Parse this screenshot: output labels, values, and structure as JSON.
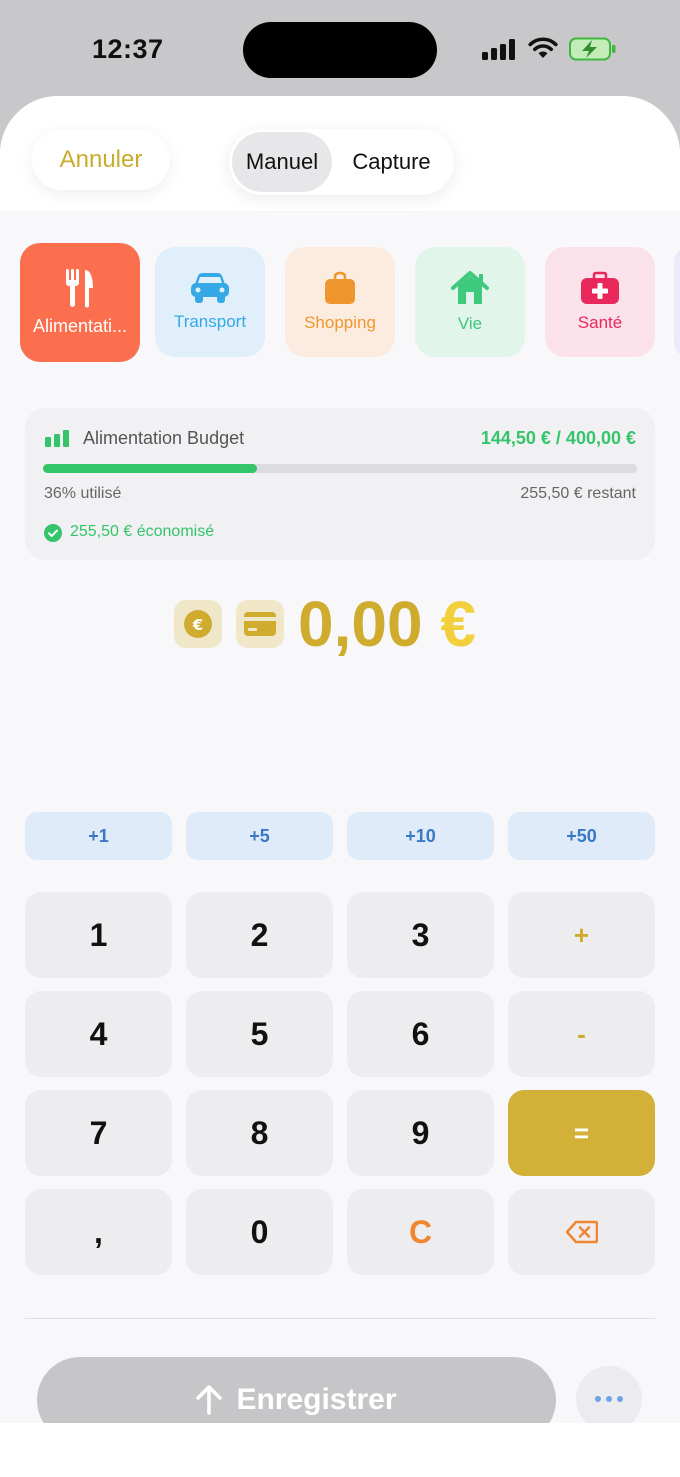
{
  "status_bar": {
    "time": "12:37"
  },
  "header": {
    "cancel_label": "Annuler",
    "tabs": [
      {
        "label": "Manuel",
        "active": true
      },
      {
        "label": "Capture",
        "active": false
      }
    ]
  },
  "categories": [
    {
      "label": "Alimentati...",
      "icon": "fork-knife-icon",
      "color": "#fb6f4f",
      "selected": true
    },
    {
      "label": "Transport",
      "icon": "car-icon",
      "color": "#35a9e6"
    },
    {
      "label": "Shopping",
      "icon": "bag-icon",
      "color": "#f0962e"
    },
    {
      "label": "Vie",
      "icon": "house-icon",
      "color": "#3ec97c"
    },
    {
      "label": "Santé",
      "icon": "medical-kit-icon",
      "color": "#e8285a"
    }
  ],
  "budget": {
    "title": "Alimentation Budget",
    "amount": "144,50 € / 400,00 €",
    "progress_fraction": 0.36,
    "used": "36% utilisé",
    "remaining": "255,50 € restant",
    "saved": "255,50 € économisé"
  },
  "amount": {
    "value": "0,00",
    "currency": "€"
  },
  "quick_add": [
    "+1",
    "+5",
    "+10",
    "+50"
  ],
  "keypad": {
    "rows": [
      [
        "1",
        "2",
        "3",
        "+"
      ],
      [
        "4",
        "5",
        "6",
        "-"
      ],
      [
        "7",
        "8",
        "9",
        "="
      ],
      [
        ",",
        "0",
        "C",
        "backspace"
      ]
    ]
  },
  "footer": {
    "save_label": "Enregistrer"
  },
  "colors": {
    "accent": "#d3b037",
    "success": "#34c46a",
    "clear": "#f0862d",
    "quick": "#3a78c4"
  }
}
